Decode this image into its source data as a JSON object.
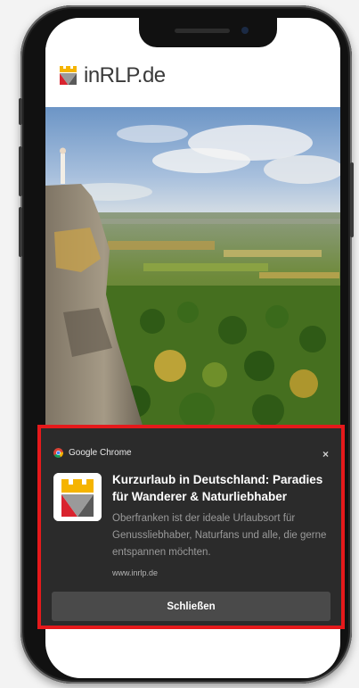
{
  "site": {
    "logo_text": "inRLP.de"
  },
  "notification": {
    "app_name": "Google Chrome",
    "close_label": "×",
    "title": "Kurzurlaub in Deutschland: Paradies für Wanderer & Naturliebhaber",
    "body": "Oberfranken ist der ideale Urlaubsort für Genussliebhaber, Naturfans und alle, die gerne entspannen möchten.",
    "url": "www.inrlp.de",
    "button_label": "Schließen"
  },
  "colors": {
    "highlight_border": "#e5191b",
    "notification_bg": "#2b2b2b",
    "button_bg": "#4a4a4a",
    "logo_red": "#d9232e",
    "logo_yellow": "#f5b400",
    "logo_gray": "#5a5a5a"
  },
  "icons": {
    "app_icon": "chrome-icon",
    "site_logo": "inrlp-logo-icon"
  }
}
